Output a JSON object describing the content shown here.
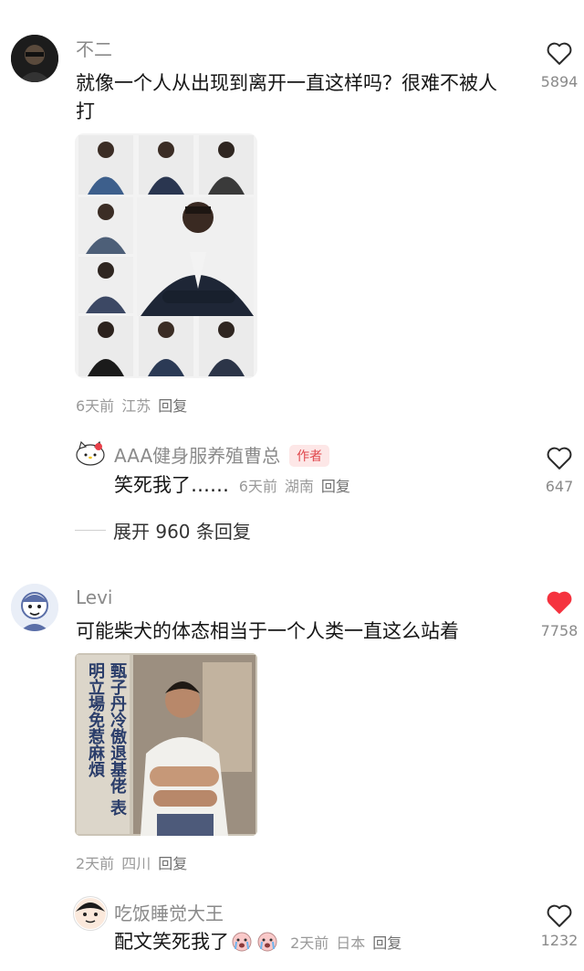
{
  "comments": [
    {
      "user": "不二",
      "text": "就像一个人从出现到离开一直这样吗？很难不被人打",
      "date": "6天前",
      "location": "江苏",
      "reply_label": "回复",
      "likes": "5894",
      "liked": false,
      "image_icon": "group-portrait-photo"
    },
    {
      "user": "Levi",
      "text": "可能柴犬的体态相当于一个人类一直这么站着",
      "date": "2天前",
      "location": "四川",
      "reply_label": "回复",
      "likes": "7758",
      "liked": true,
      "image_caption": "甄子丹冷傲退基佬 表明立場免惹麻煩",
      "image_icon": "magazine-portrait-photo"
    }
  ],
  "replies": [
    {
      "user": "AAA健身服养殖曹总",
      "badge": "作者",
      "text": "笑死我了……",
      "date": "6天前",
      "location": "湖南",
      "reply_label": "回复",
      "likes": "647",
      "avatar_icon": "hello-kitty-avatar"
    },
    {
      "user": "吃饭睡觉大王",
      "text": "配文笑死我了",
      "emoji": "crying-face-emoji",
      "date": "2天前",
      "location": "日本",
      "reply_label": "回复",
      "likes": "1232",
      "avatar_icon": "cartoon-face-avatar"
    }
  ],
  "expand_label": "展开 960 条回复",
  "colors": {
    "liked": "#f5333f",
    "text": "#161616",
    "meta": "#9a9a9a",
    "badge_bg": "#fde7e7"
  }
}
